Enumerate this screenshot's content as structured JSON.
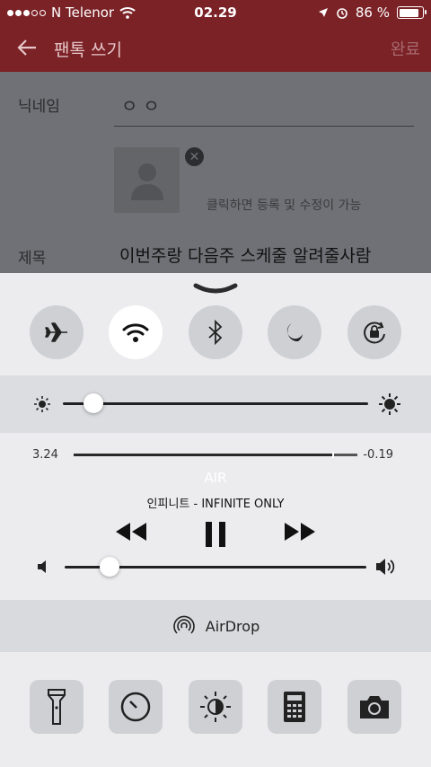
{
  "status_bar": {
    "carrier": "N Telenor",
    "time": "02.29",
    "battery_percent": "86 %",
    "battery_level": 0.86,
    "signal_bars_filled": 3,
    "icons": [
      "signal-dots-icon",
      "wifi-icon",
      "location-arrow-icon",
      "alarm-icon",
      "battery-icon"
    ]
  },
  "app_bar": {
    "title": "팬톡 쓰기",
    "done_label": "완료",
    "back_icon": "arrow-left-icon"
  },
  "form": {
    "nickname_label": "닉네임",
    "nickname_value": "ㅇㅇ",
    "photo_hint": "클릭하면 등록 및 수정이 가능",
    "subject_label": "제목",
    "subject_value": "이번주랑 다음주 스케줄 알려줄사람"
  },
  "control_center": {
    "toggles": [
      {
        "name": "airplane-mode",
        "icon": "airplane-icon",
        "on": false
      },
      {
        "name": "wifi",
        "icon": "wifi-icon",
        "on": true
      },
      {
        "name": "bluetooth",
        "icon": "bluetooth-icon",
        "on": false
      },
      {
        "name": "do-not-disturb",
        "icon": "moon-icon",
        "on": false
      },
      {
        "name": "rotation-lock",
        "icon": "rotation-lock-icon",
        "on": false
      }
    ],
    "brightness_level": 0.1,
    "music": {
      "elapsed": "3.24",
      "remaining": "-0.19",
      "progress": 0.91,
      "song": "AIR",
      "artist_album": "인피니트 - INFINITE ONLY",
      "volume_level": 0.15
    },
    "airdrop_label": "AirDrop",
    "shortcuts": [
      "flashlight-icon",
      "timer-icon",
      "night-shift-icon",
      "calculator-icon",
      "camera-icon"
    ],
    "colors": {
      "accent_bar": "#7b2227",
      "panel": "#ececee",
      "toggle_on": "#ffffff",
      "toggle_off": "#cfd0d3"
    }
  }
}
